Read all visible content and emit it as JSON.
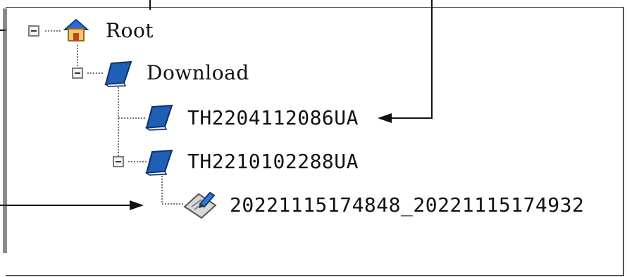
{
  "tree": {
    "root": {
      "label": "Root",
      "icon": "home-icon",
      "expanded": true
    },
    "download": {
      "label": "Download",
      "icon": "book-icon",
      "expanded": true
    },
    "folder1": {
      "label": "TH2204112086UA",
      "icon": "book-icon"
    },
    "folder2": {
      "label": "TH2210102288UA",
      "icon": "book-icon",
      "expanded": true
    },
    "record": {
      "label": "20221115174848_20221115174932",
      "icon": "document-edit-icon"
    }
  },
  "colors": {
    "book": "#1f5fb5",
    "house_roof": "#2a6ad8",
    "house_wall": "#f2c86a"
  }
}
